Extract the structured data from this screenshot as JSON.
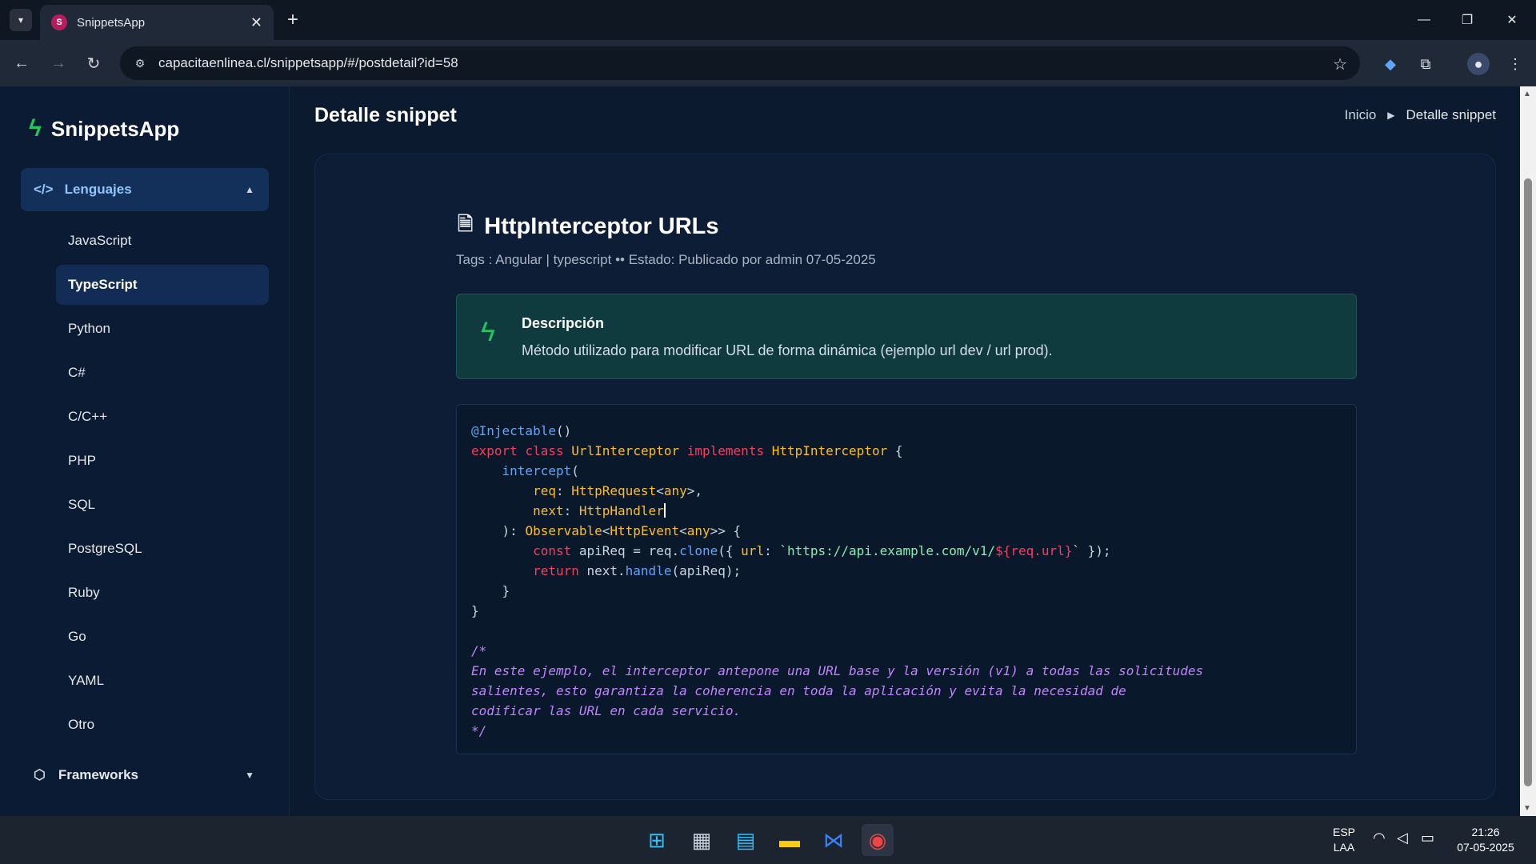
{
  "browser": {
    "tab_title": "SnippetsApp",
    "url": "capacitaenlinea.cl/snippetsapp/#/postdetail?id=58"
  },
  "sidebar": {
    "brand": "SnippetsApp",
    "group_label": "Lenguajes",
    "items": [
      {
        "label": "JavaScript"
      },
      {
        "label": "TypeScript"
      },
      {
        "label": "Python"
      },
      {
        "label": "C#"
      },
      {
        "label": "C/C++"
      },
      {
        "label": "PHP"
      },
      {
        "label": "SQL"
      },
      {
        "label": "PostgreSQL"
      },
      {
        "label": "Ruby"
      },
      {
        "label": "Go"
      },
      {
        "label": "YAML"
      },
      {
        "label": "Otro"
      }
    ],
    "active_item": "TypeScript",
    "frameworks_label": "Frameworks"
  },
  "header": {
    "title": "Detalle snippet",
    "breadcrumb_home": "Inicio",
    "breadcrumb_current": "Detalle snippet"
  },
  "post": {
    "title": "HttpInterceptor URLs",
    "meta": "Tags : Angular | typescript •• Estado: Publicado por admin 07-05-2025",
    "description_title": "Descripción",
    "description_text": "Método utilizado para modificar URL de forma dinámica (ejemplo url dev / url prod)."
  },
  "taskbar": {
    "lang_top": "ESP",
    "lang_bottom": "LAA",
    "time": "21:26",
    "date": "07-05-2025"
  },
  "icons": {
    "accent": "#22c55e",
    "sidebar_bg": "#0a1b33",
    "description_bg": "#0f3b3f"
  }
}
